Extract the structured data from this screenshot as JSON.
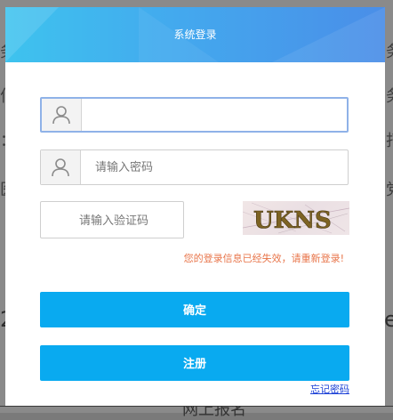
{
  "dialog": {
    "title": "系统登录",
    "username": {
      "value": "",
      "placeholder": ""
    },
    "password": {
      "value": "",
      "placeholder": "请输入密码"
    },
    "captcha": {
      "value": "",
      "placeholder": "请输入验证码",
      "image_text": "UKNS"
    },
    "error_message": "您的登录信息已经失效，请重新登录!",
    "confirm_label": "确定",
    "register_label": "注册",
    "forgot_label": "忘记密码"
  },
  "background": {
    "footer_tab": "网上报名"
  },
  "colors": {
    "header_start": "#3ec3ee",
    "header_end": "#4a8ee8",
    "button": "#09aaf0",
    "error": "#e8754a",
    "link": "#1a3fd6"
  }
}
